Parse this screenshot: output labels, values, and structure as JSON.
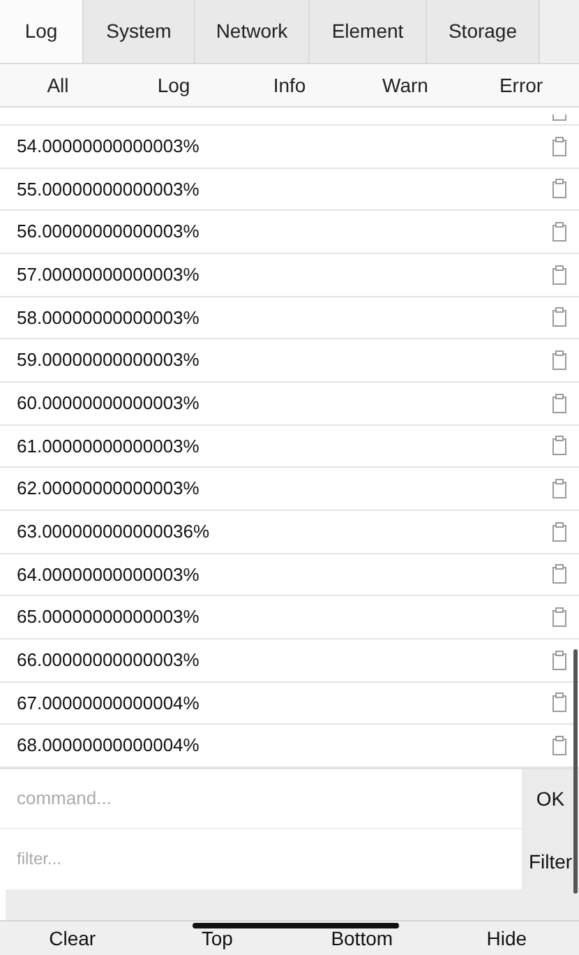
{
  "tabs": [
    {
      "label": "Log",
      "selected": true
    },
    {
      "label": "System",
      "selected": false
    },
    {
      "label": "Network",
      "selected": false
    },
    {
      "label": "Element",
      "selected": false
    },
    {
      "label": "Storage",
      "selected": false
    }
  ],
  "filters": [
    {
      "label": "All"
    },
    {
      "label": "Log"
    },
    {
      "label": "Info"
    },
    {
      "label": "Warn"
    },
    {
      "label": "Error"
    }
  ],
  "log_rows": [
    "54.00000000000003%",
    "55.00000000000003%",
    "56.00000000000003%",
    "57.00000000000003%",
    "58.00000000000003%",
    "59.00000000000003%",
    "60.00000000000003%",
    "61.00000000000003%",
    "62.00000000000003%",
    "63.000000000000036%",
    "64.00000000000003%",
    "65.00000000000003%",
    "66.00000000000003%",
    "67.00000000000004%",
    "68.00000000000004%"
  ],
  "command": {
    "placeholder": "command...",
    "button": "OK"
  },
  "filter": {
    "placeholder": "filter...",
    "button": "Filter"
  },
  "toolbar": [
    "Clear",
    "Top",
    "Bottom",
    "Hide"
  ]
}
